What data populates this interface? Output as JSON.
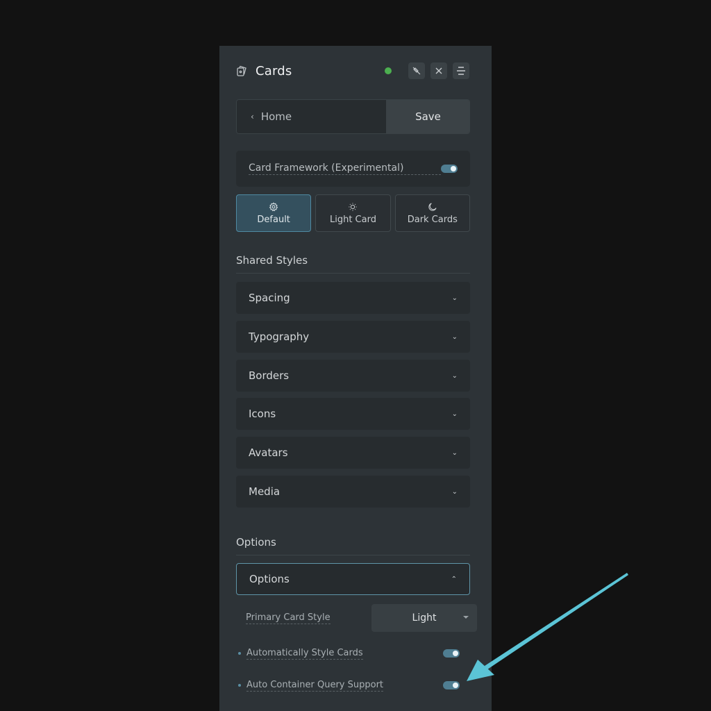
{
  "header": {
    "title": "Cards",
    "logo_icon": "cards-icon",
    "status_color": "#4caf50",
    "buttons": [
      {
        "name": "unpin-button",
        "icon": "unpin-icon"
      },
      {
        "name": "close-button",
        "icon": "close-icon"
      },
      {
        "name": "menu-button",
        "icon": "menu-icon"
      }
    ]
  },
  "nav": {
    "home_label": "Home",
    "save_label": "Save"
  },
  "framework": {
    "label": "Card Framework (Experimental)",
    "enabled": true
  },
  "modes": [
    {
      "label": "Default",
      "icon": "gear-icon",
      "active": true
    },
    {
      "label": "Light Card",
      "icon": "sun-icon",
      "active": false
    },
    {
      "label": "Dark Cards",
      "icon": "moon-icon",
      "active": false
    }
  ],
  "shared_styles": {
    "title": "Shared Styles",
    "items": [
      {
        "label": "Spacing"
      },
      {
        "label": "Typography"
      },
      {
        "label": "Borders"
      },
      {
        "label": "Icons"
      },
      {
        "label": "Avatars"
      },
      {
        "label": "Media"
      }
    ]
  },
  "options": {
    "title": "Options",
    "accordion_label": "Options",
    "primary_card_style": {
      "label": "Primary Card Style",
      "value": "Light"
    },
    "toggles": [
      {
        "label": "Automatically Style Cards",
        "enabled": true
      },
      {
        "label": "Auto Container Query Support",
        "enabled": true
      }
    ]
  },
  "annotation": {
    "arrow_color": "#5bc4d6"
  }
}
